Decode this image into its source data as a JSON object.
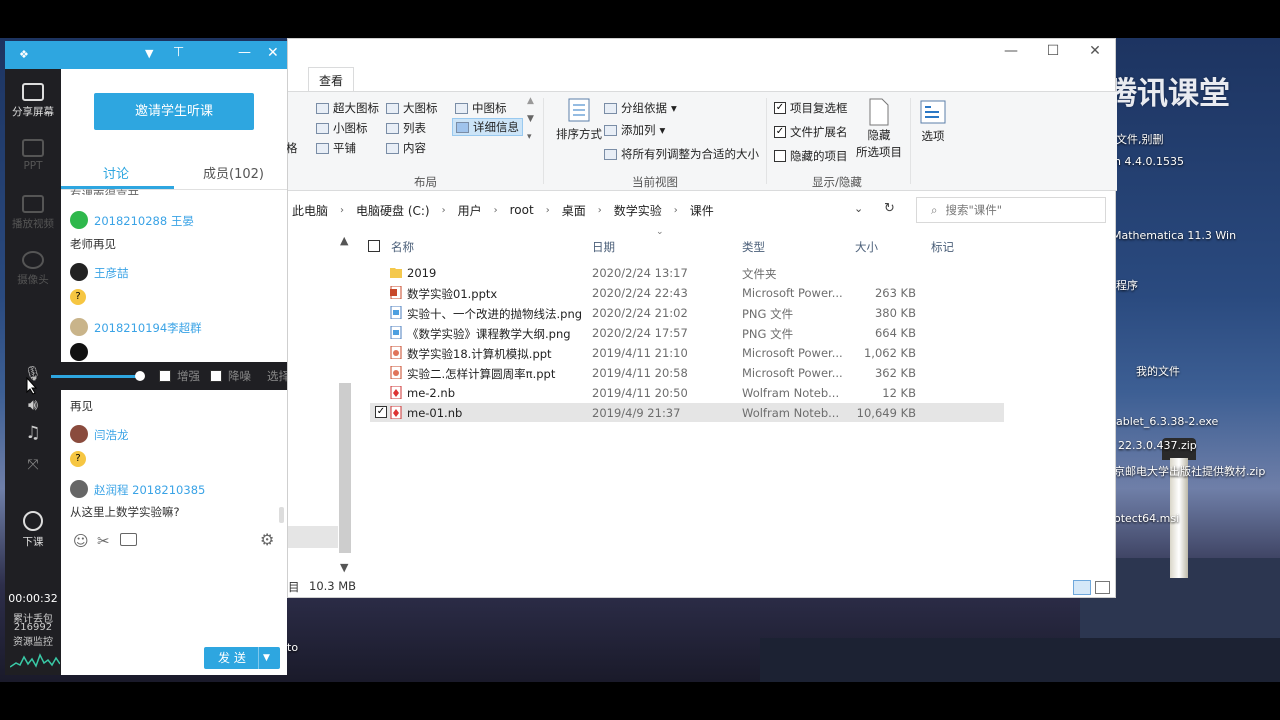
{
  "explorer": {
    "tab_view": "查看",
    "ribbon": {
      "layout": {
        "extra_large": "超大图标",
        "large": "大图标",
        "medium": "中图标",
        "small": "小图标",
        "list": "列表",
        "details": "详细信息",
        "tiles": "平铺",
        "content": "内容",
        "group_label": "布局"
      },
      "current_view": {
        "sort_by": "排序方式",
        "group_by": "分组依据",
        "add_columns": "添加列",
        "size_all_columns": "将所有列调整为合适的大小",
        "group_label": "当前视图"
      },
      "show_hide": {
        "item_checkboxes": "项目复选框",
        "file_extensions": "文件扩展名",
        "hidden_items": "隐藏的项目",
        "hide_selected_line1": "隐藏",
        "hide_selected_line2": "所选项目",
        "group_label": "显示/隐藏"
      },
      "options": "选项",
      "left_fragment_tab": "格"
    },
    "breadcrumb": [
      "此电脑",
      "电脑硬盘 (C:)",
      "用户",
      "root",
      "桌面",
      "数学实验",
      "课件"
    ],
    "search_placeholder": "搜索\"课件\"",
    "columns": {
      "name": "名称",
      "date": "日期",
      "type": "类型",
      "size": "大小",
      "tags": "标记"
    },
    "files": [
      {
        "name": "2019",
        "date": "2020/2/24 13:17",
        "type": "文件夹",
        "size": "",
        "kind": "folder"
      },
      {
        "name": "数学实验01.pptx",
        "date": "2020/2/24 22:43",
        "type": "Microsoft Power...",
        "size": "263 KB",
        "kind": "pptx"
      },
      {
        "name": "实验十、一个改进的抛物线法.png",
        "date": "2020/2/24 21:02",
        "type": "PNG 文件",
        "size": "380 KB",
        "kind": "png"
      },
      {
        "name": "《数学实验》课程教学大纲.png",
        "date": "2020/2/24 17:57",
        "type": "PNG 文件",
        "size": "664 KB",
        "kind": "png"
      },
      {
        "name": "数学实验18.计算机模拟.ppt",
        "date": "2019/4/11 21:10",
        "type": "Microsoft Power...",
        "size": "1,062 KB",
        "kind": "ppt"
      },
      {
        "name": "实验二.怎样计算圆周率π.ppt",
        "date": "2019/4/11 20:58",
        "type": "Microsoft Power...",
        "size": "362 KB",
        "kind": "ppt"
      },
      {
        "name": "me-2.nb",
        "date": "2019/4/11 20:50",
        "type": "Wolfram Noteb...",
        "size": "12 KB",
        "kind": "nb"
      },
      {
        "name": "me-01.nb",
        "date": "2019/4/9 21:37",
        "type": "Wolfram Noteb...",
        "size": "10,649 KB",
        "kind": "nb",
        "selected": true
      }
    ],
    "status_fragment": "目",
    "status_size": "10.3 MB"
  },
  "tencent": {
    "sidebar": {
      "share_screen": "分享屏幕",
      "ppt": "PPT",
      "play_video": "播放视频",
      "camera": "摄像头",
      "end_class": "下课",
      "timer": "00:00:32",
      "packet_loss_label": "累计丢包",
      "packet_loss_value": "216992",
      "resource_monitor": "资源监控"
    },
    "invite_button": "邀请学生听课",
    "tabs": {
      "discussion": "讨论",
      "members": "成员(102)"
    },
    "messages_top": {
      "cut_text": "有课面得高开",
      "m1_name": "2018210288 王晏",
      "m1_text": "老师再见",
      "m2_name": "王彦喆",
      "m3_name": "2018210194李超群"
    },
    "audio": {
      "enhance": "增强",
      "denoise": "降噪",
      "select": "选择"
    },
    "messages_bottom": {
      "b0_text": "再见",
      "b1_name": "闫浩龙",
      "b2_name": "赵润程 2018210385",
      "b2_text": "从这里上数学实验嘛?"
    },
    "send_button": "发 送"
  },
  "desktop": {
    "watermark": "腾讯课堂",
    "labels": [
      "文件,别删",
      "n 4.4.0.1535",
      "Mathematica 11.3 Win",
      "程序",
      "我的文件",
      "ablet_6.3.38-2.exe",
      "22.3.0.437.zip",
      "京邮电大学出版社提供教材.zip",
      "otect64.msi"
    ],
    "edge_fragment": "to"
  },
  "colors": {
    "accent": "#2ea6e0",
    "sidebar": "#1f1f23",
    "selection": "#e5e5e5"
  }
}
